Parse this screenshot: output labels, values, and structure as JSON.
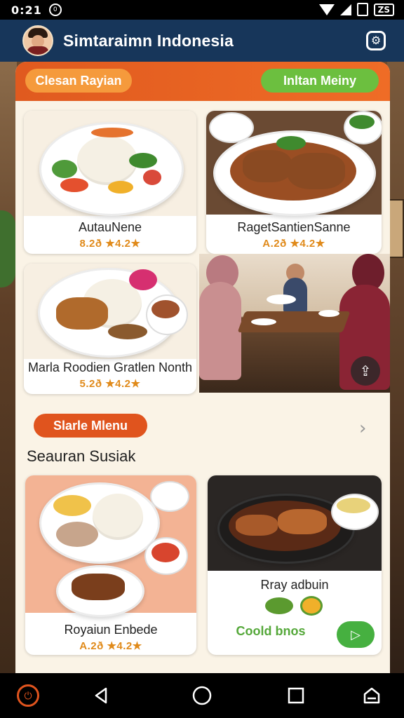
{
  "status_bar": {
    "time": "0:21",
    "notification_icon": "0",
    "battery": "ZS"
  },
  "app_bar": {
    "title": "Simtaraimn Indonesia",
    "settings_icon": "gear-icon"
  },
  "top_tabs": {
    "left": "Clesan Rayian",
    "right": "Inltan Meiny"
  },
  "featured_cards": [
    {
      "name": "AutauNene",
      "price": "8.2ð ★4.2★"
    },
    {
      "name": "RagetSantienSanne",
      "price": "A.2ð ★4.2★"
    },
    {
      "name": "Marla Roodien Gratlen Nonth",
      "price": "5.2ð ★4.2★"
    }
  ],
  "section2": {
    "menu_pill": "Slarle Mlenu",
    "title": "Seauran Susiak",
    "cards": [
      {
        "name": "Royaiun Enbede",
        "price": "A.2ð ★4.2★"
      },
      {
        "name": "Rray adbuin",
        "cta_text": "Coold bnos",
        "cta_icon": "arrow-right-icon"
      }
    ]
  },
  "nav_bar": {
    "icons": [
      "power-icon",
      "back-icon",
      "home-icon",
      "recent-apps-icon",
      "keyboard-icon"
    ]
  }
}
